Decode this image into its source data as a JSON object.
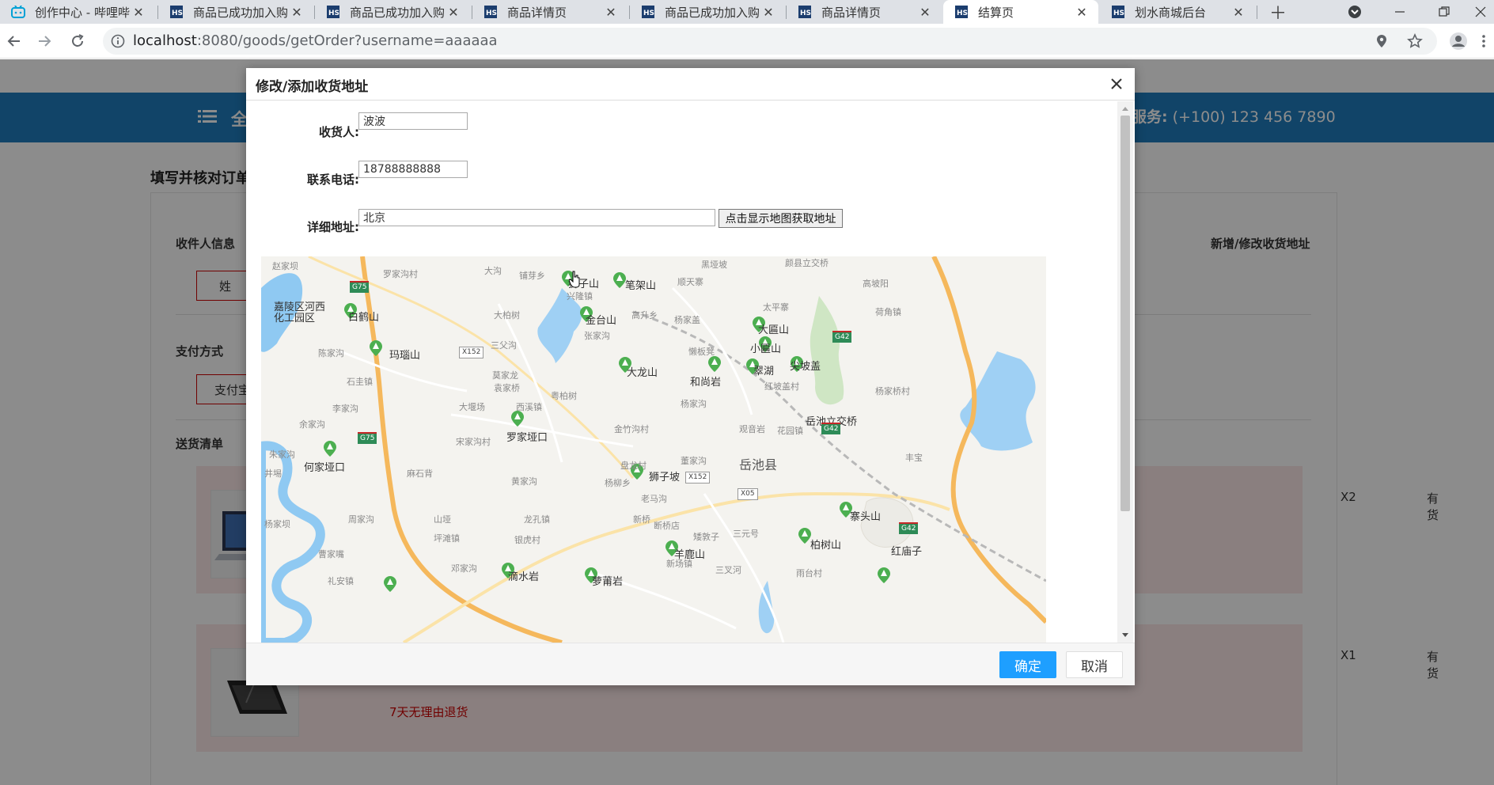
{
  "browser": {
    "tabs": [
      {
        "title": "创作中心 - 哔哩哔",
        "active": false
      },
      {
        "title": "商品已成功加入购",
        "active": false
      },
      {
        "title": "商品已成功加入购",
        "active": false
      },
      {
        "title": "商品详情页",
        "active": false
      },
      {
        "title": "商品已成功加入购",
        "active": false
      },
      {
        "title": "商品详情页",
        "active": false
      },
      {
        "title": "结算页",
        "active": true
      },
      {
        "title": "划水商城后台",
        "active": false
      }
    ],
    "url_host": "localhost",
    "url_rest": ":8080/goods/getOrder?username=aaaaaa"
  },
  "page": {
    "menu_label": "全",
    "service_label": "服务:",
    "service_phone": " (+100) 123 456 7890",
    "page_title": "填写并核对订单",
    "receiver_section": "收件人信息",
    "receiver_btn": "姓",
    "new_address_link": "新增/修改收货地址",
    "payment_section": "支付方式",
    "payment_btn": "支付宝",
    "delivery_section": "送货清单",
    "items": [
      {
        "qty": "X2",
        "stock": "有货"
      },
      {
        "qty": "X1",
        "stock": "有货"
      }
    ],
    "refund_note": "7天无理由退货"
  },
  "modal": {
    "title": "修改/添加收货地址",
    "receiver_label": "收货人:",
    "receiver_value": "波波",
    "phone_label": "联系电话:",
    "phone_value": "18788888888",
    "address_label": "详细地址:",
    "address_value": "北京",
    "map_button": "点击显示地图获取地址",
    "ok_button": "确定",
    "cancel_button": "取消"
  },
  "map": {
    "labels": [
      "赵家坝",
      "罗家沟村",
      "大沟",
      "铺芽乡",
      "狮子山",
      "笔架山",
      "黑垭坡",
      "顺天寨",
      "颜县立交桥",
      "高坡阳",
      "嘉陵区河西化工园区",
      "白鹤山",
      "大柏树",
      "兴隆镇",
      "金台山",
      "高升乡",
      "杨家盖",
      "太平寨",
      "荷角镇",
      "大匾山",
      "小匾山",
      "三父沟",
      "张家沟",
      "陈家沟",
      "玛瑙山",
      "懒板凳",
      "翠湖",
      "尖坡盖",
      "莫家龙",
      "石圭镇",
      "袁家桥",
      "大龙山",
      "和尚岩",
      "红坡盖村",
      "杨家桥村",
      "李家沟",
      "大堰场",
      "西溪镇",
      "粤柏树",
      "杨家沟",
      "余家沟",
      "罗家垭口",
      "金竹沟村",
      "观音岩",
      "花园镇",
      "岳池立交桥",
      "宋家沟村",
      "朱家沟",
      "何家垭口",
      "麻石背",
      "盘龙村",
      "董家沟",
      "岳池县",
      "丰宝",
      "井埸",
      "黄家沟",
      "杨柳乡",
      "狮子坡",
      "老马沟",
      "寨头山",
      "周家沟",
      "山垭",
      "龙孔镇",
      "新桥",
      "断桥店",
      "矮敦子",
      "三元号",
      "杨家坝",
      "坪滩镇",
      "银虎村",
      "柏树山",
      "红庙子",
      "曹家嘴",
      "邓家沟",
      "新场镇",
      "羊鹿山",
      "三叉河",
      "滴水岩",
      "萝莆岩",
      "雨台村",
      "礼安镇"
    ],
    "shields": [
      "G75",
      "G75",
      "G42",
      "G42",
      "G42",
      "X152",
      "X152",
      "X05"
    ]
  }
}
